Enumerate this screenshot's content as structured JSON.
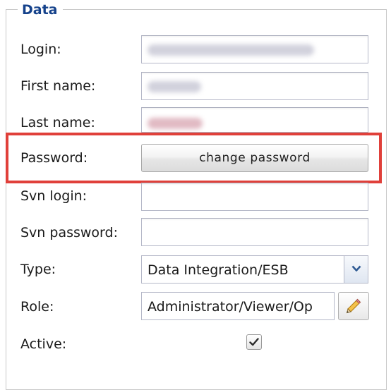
{
  "section": {
    "legend": "Data"
  },
  "fields": {
    "login": {
      "label": "Login:",
      "value": ""
    },
    "first_name": {
      "label": "First name:",
      "value": ""
    },
    "last_name": {
      "label": "Last name:",
      "value": ""
    },
    "password": {
      "label": "Password:",
      "button_label": "change password"
    },
    "svn_login": {
      "label": "Svn login:",
      "value": ""
    },
    "svn_password": {
      "label": "Svn password:",
      "value": ""
    },
    "type": {
      "label": "Type:",
      "selected": "Data Integration/ESB"
    },
    "role": {
      "label": "Role:",
      "value": "Administrator/Viewer/Op"
    },
    "active": {
      "label": "Active:",
      "checked": true
    }
  },
  "colors": {
    "legend": "#15428b",
    "highlight": "#e0403a",
    "field_border": "#b5b8c8"
  },
  "icons": {
    "type_trigger": "chevron-down-icon",
    "role_edit": "pencil-icon",
    "active_check": "checkmark-icon"
  }
}
